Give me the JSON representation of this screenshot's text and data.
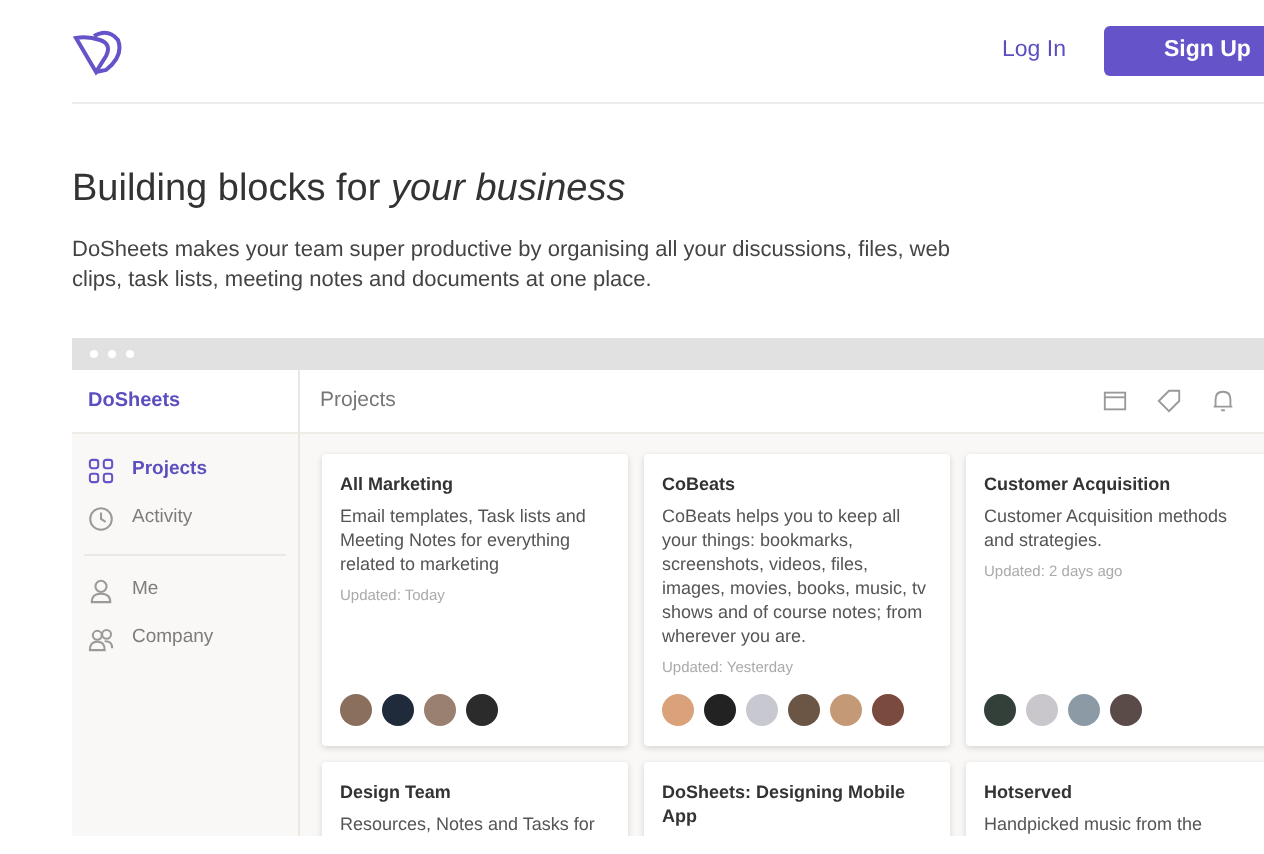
{
  "nav": {
    "login": "Log In",
    "signup": "Sign Up"
  },
  "hero": {
    "title": "Building blocks for *your business*",
    "text": "DoSheets makes your team super productive by organising all your discussions, files, web clips, task lists, meeting notes and documents at one place."
  },
  "app": {
    "brand": "DoSheets",
    "page_title": "Projects",
    "sidebar": {
      "groups": [
        [
          {
            "label": "Projects",
            "selected": true
          },
          {
            "label": "Activity",
            "selected": false
          }
        ],
        [
          {
            "label": "Me",
            "selected": false
          },
          {
            "label": "Company",
            "selected": false
          }
        ]
      ]
    },
    "cards": [
      {
        "title": "All Marketing",
        "text": "Email templates, Task lists and Meeting Notes for everything related to marketing",
        "updated": "Updated: Today",
        "avatars": [
          {
            "color": "#8a6f5c"
          },
          {
            "color": "#1f2a3a"
          },
          {
            "color": "#9a8070"
          },
          {
            "color": "#2b2b2b"
          }
        ]
      },
      {
        "title": "CoBeats",
        "text": "CoBeats helps you to keep all your things: bookmarks, screenshots, videos, files, images, movies, books, music, tv shows and of course notes; from wherever you are.",
        "updated": "Updated: Yesterday",
        "avatars": [
          {
            "color": "#d9a27a"
          },
          {
            "color": "#222222"
          },
          {
            "color": "#c8c8d0"
          },
          {
            "color": "#6b5646"
          },
          {
            "color": "#c49a76"
          },
          {
            "color": "#7a4a3e"
          }
        ]
      },
      {
        "title": "Customer Acquisition",
        "text": "Customer Acquisition methods and strategies.",
        "updated": "Updated: 2 days ago",
        "avatars": [
          {
            "color": "#33403a"
          },
          {
            "color": "#c9c6cc"
          },
          {
            "color": "#8c9aa6"
          },
          {
            "color": "#5a4a48"
          }
        ]
      },
      {
        "title": "Design Team",
        "text": "Resources, Notes and Tasks for"
      },
      {
        "title": "DoSheets: Designing Mobile App"
      },
      {
        "title": "Hotserved",
        "text": "Handpicked music from the"
      }
    ]
  }
}
